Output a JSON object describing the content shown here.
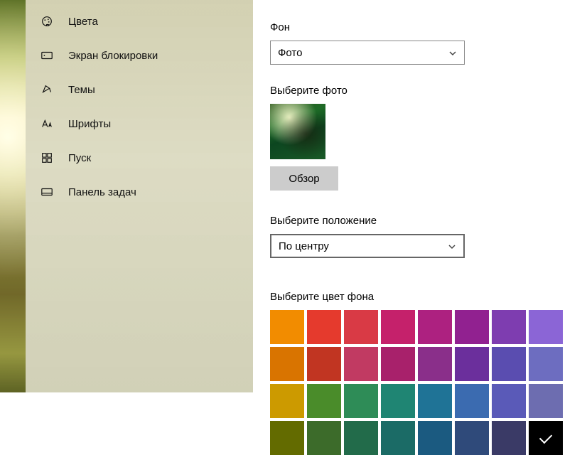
{
  "sidebar": {
    "items": [
      {
        "label": "Цвета",
        "icon": "palette-icon"
      },
      {
        "label": "Экран блокировки",
        "icon": "lockscreen-icon"
      },
      {
        "label": "Темы",
        "icon": "themes-icon"
      },
      {
        "label": "Шрифты",
        "icon": "fonts-icon"
      },
      {
        "label": "Пуск",
        "icon": "start-icon"
      },
      {
        "label": "Панель задач",
        "icon": "taskbar-icon"
      }
    ]
  },
  "main": {
    "background_label": "Фон",
    "background_value": "Фото",
    "choose_photo_label": "Выберите фото",
    "browse_label": "Обзор",
    "fit_label": "Выберите положение",
    "fit_value": "По центру",
    "bg_color_label": "Выберите цвет фона",
    "swatches": [
      [
        "#f28c00",
        "#e53a2d",
        "#d93a45",
        "#c5216b",
        "#ad2180",
        "#912190",
        "#7e3db0",
        "#8b65d6"
      ],
      [
        "#d97400",
        "#c13522",
        "#c13a62",
        "#a8216b",
        "#8a2f8a",
        "#6b2f9c",
        "#5a4db0",
        "#6d6dc0"
      ],
      [
        "#cc9a00",
        "#4a8c2a",
        "#2e8c57",
        "#1f8573",
        "#1f7396",
        "#3b6bb0",
        "#5a5ab8",
        "#6d6db0"
      ],
      [
        "#636b00",
        "#3c6b2a",
        "#226b4a",
        "#1b6b66",
        "#1b5a80",
        "#2f4a7a",
        "#3a3a66",
        "#000000"
      ]
    ],
    "selected_swatch": [
      3,
      7
    ]
  }
}
